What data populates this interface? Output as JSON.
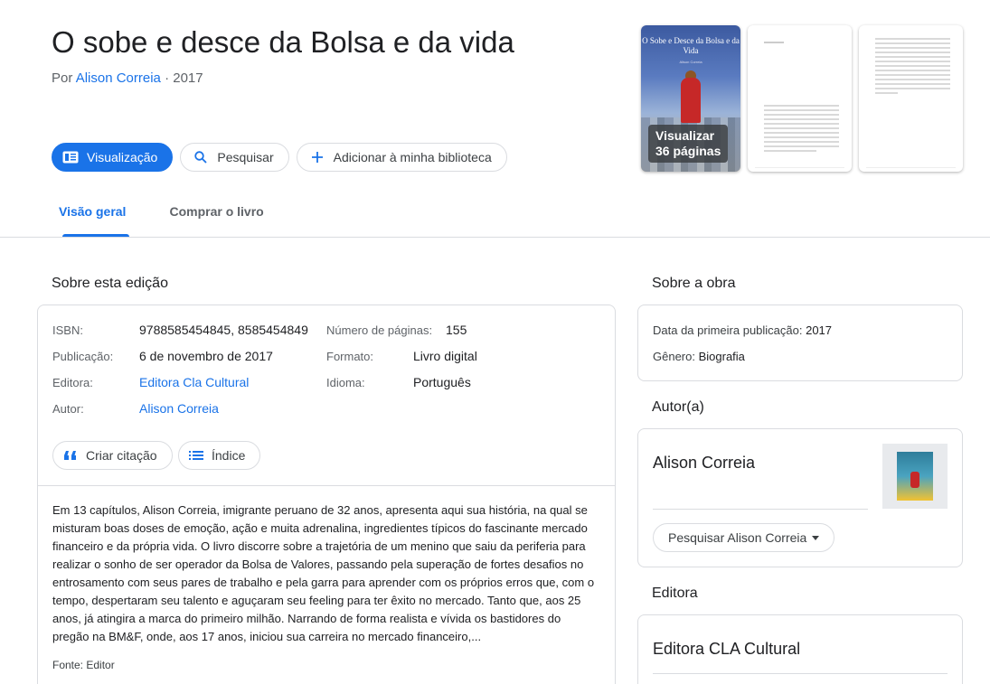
{
  "book": {
    "title": "O sobe e desce da Bolsa e da vida",
    "by_prefix": "Por ",
    "author": "Alison Correia",
    "year_sep": " · 2017"
  },
  "actions": {
    "preview": "Visualização",
    "search": "Pesquisar",
    "add_library": "Adicionar à minha biblioteca"
  },
  "thumbnails": {
    "cover_title": "O Sobe e Desce da Bolsa e da Vida",
    "cover_author": "Alison Correia",
    "badge_line1": "Visualizar",
    "badge_line2": "36 páginas"
  },
  "tabs": [
    {
      "label": "Visão geral",
      "active": true
    },
    {
      "label": "Comprar o livro",
      "active": false
    }
  ],
  "about_edition": {
    "heading": "Sobre esta edição",
    "fields": {
      "isbn_label": "ISBN:",
      "isbn_value": "9788585454845, 8585454849",
      "pub_label": "Publicação:",
      "pub_value": "6 de novembro de 2017",
      "publisher_label": "Editora:",
      "publisher_value": "Editora Cla Cultural",
      "author_label": "Autor:",
      "author_value": "Alison Correia",
      "pages_label": "Número de páginas:",
      "pages_value": "155",
      "format_label": "Formato:",
      "format_value": "Livro digital",
      "language_label": "Idioma:",
      "language_value": "Português"
    },
    "chips": {
      "cite": "Criar citação",
      "index": "Índice"
    },
    "description": " Em 13 capítulos, Alison Correia, imigrante peruano de 32 anos, apresenta aqui sua história, na qual se misturam boas doses de emoção, ação e muita adrenalina, ingredientes típicos do fascinante mercado financeiro e da própria vida. O livro discorre sobre a trajetória de um menino que saiu da periferia para realizar o sonho de ser operador da Bolsa de Valores, passando pela superação de fortes desafios no entrosamento com seus pares de trabalho e pela garra para aprender com os próprios erros que, com o tempo, despertaram seu talento e aguçaram seu feeling para ter êxito no mercado. Tanto que, aos 25 anos, já atingira a marca do primeiro milhão. Narrando de forma realista e vívida os bastidores do pregão na BM&F, onde, aos 17 anos, iniciou sua carreira no mercado financeiro,...",
    "source": "Fonte: Editor"
  },
  "about_work": {
    "heading": "Sobre a obra",
    "first_pub_label": "Data da primeira publicação: ",
    "first_pub_value": "2017",
    "genre_label": "Gênero: ",
    "genre_value": "Biografia"
  },
  "author_section": {
    "heading": "Autor(a)",
    "name": "Alison Correia",
    "search_button": "Pesquisar Alison Correia"
  },
  "publisher_section": {
    "heading": "Editora",
    "name": "Editora CLA Cultural"
  },
  "colors": {
    "accent": "#1a73e8",
    "text": "#202124",
    "muted": "#5f6368",
    "border": "#dadce0"
  }
}
